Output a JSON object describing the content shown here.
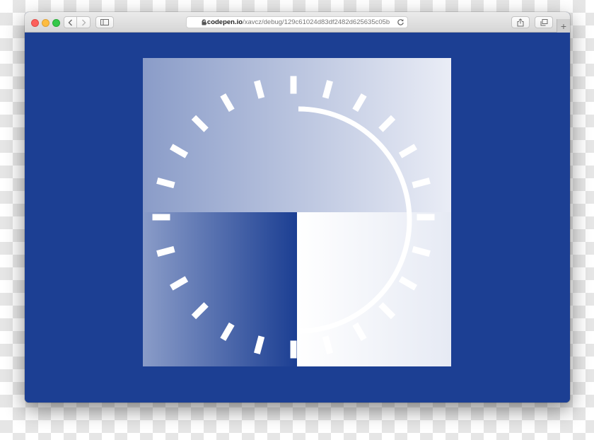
{
  "browser": {
    "url_host": "s.codepen.io",
    "url_path": "/xavcz/debug/129c61024d83df2482d625635c05b"
  },
  "icons": {
    "lock": "lock-icon",
    "reload": "reload-icon",
    "back": "chevron-left-icon",
    "forward": "chevron-right-icon",
    "sidebar": "sidebar-icon",
    "share": "share-icon",
    "tabs": "tabs-icon",
    "new_tab": "plus-icon"
  },
  "colors": {
    "page_background": "#1c3f93",
    "artwork_light": "#ffffff",
    "artwork_tint": "#8a9cc8"
  }
}
